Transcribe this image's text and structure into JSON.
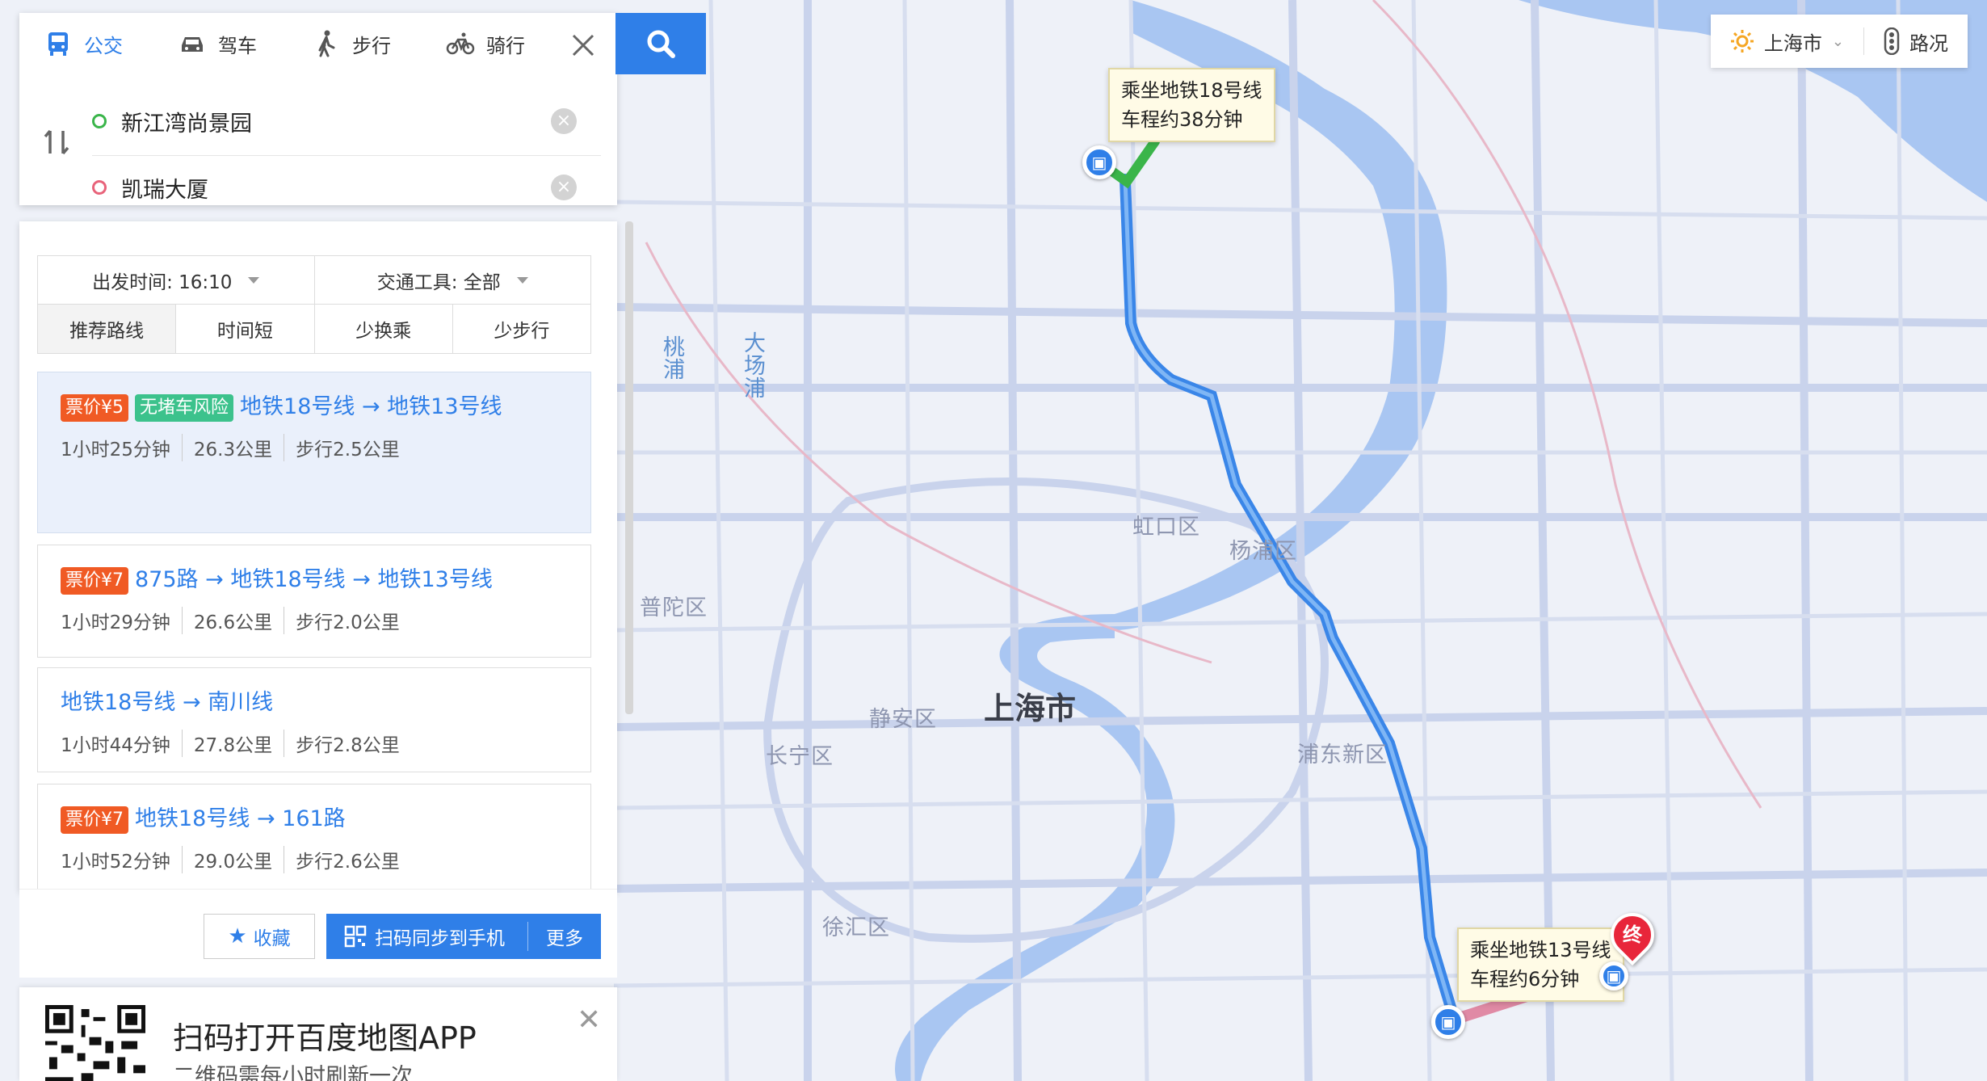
{
  "modes": [
    {
      "label": "公交",
      "icon": "bus-icon",
      "active": true
    },
    {
      "label": "驾车",
      "icon": "car-icon",
      "active": false
    },
    {
      "label": "步行",
      "icon": "walk-icon",
      "active": false
    },
    {
      "label": "骑行",
      "icon": "bike-icon",
      "active": false
    }
  ],
  "origin": "新江湾尚景园",
  "destination": "凯瑞大厦",
  "filters": {
    "depart_label": "出发时间: 16:10",
    "vehicle_label": "交通工具: 全部",
    "sort_tabs": [
      "推荐路线",
      "时间短",
      "少换乘",
      "少步行"
    ],
    "selected_sort": "推荐路线"
  },
  "routes": [
    {
      "fare": "票价¥5",
      "tag": "无堵车风险",
      "title": "地铁18号线 → 地铁13号线",
      "duration": "1小时25分钟",
      "distance": "26.3公里",
      "walk": "步行2.5公里"
    },
    {
      "fare": "票价¥7",
      "tag": "",
      "title": "875路 → 地铁18号线 → 地铁13号线",
      "duration": "1小时29分钟",
      "distance": "26.6公里",
      "walk": "步行2.0公里"
    },
    {
      "fare": "",
      "tag": "",
      "title": "地铁18号线 → 南川线",
      "duration": "1小时44分钟",
      "distance": "27.8公里",
      "walk": "步行2.8公里"
    },
    {
      "fare": "票价¥7",
      "tag": "",
      "title": "地铁18号线 → 161路",
      "duration": "1小时52分钟",
      "distance": "29.0公里",
      "walk": "步行2.6公里"
    }
  ],
  "actions": {
    "favorite": "收藏",
    "sync": "扫码同步到手机",
    "more": "更多"
  },
  "promo": {
    "title": "扫码打开百度地图APP",
    "subtitle": "二维码需每小时刷新一次"
  },
  "top_right": {
    "city": "上海市",
    "traffic": "路况"
  },
  "map": {
    "city_label": "上海市",
    "districts": [
      "虹口区",
      "杨浦区",
      "普陀区",
      "静安区",
      "长宁区",
      "浦东新区",
      "徐汇区"
    ],
    "rivers": [
      "桃浦",
      "大场浦"
    ],
    "end_marker": "终",
    "bubble_start": {
      "line1": "乘坐地铁18号线",
      "line2": "车程约38分钟"
    },
    "bubble_end": {
      "line1": "乘坐地铁13号线",
      "line2": "车程约6分钟"
    }
  },
  "colors": {
    "accent": "#2f7fe8",
    "fare": "#f05a24",
    "nojam": "#3cc28c",
    "walk_route": "#3ab54a",
    "transfer_route": "#e08aa5"
  }
}
